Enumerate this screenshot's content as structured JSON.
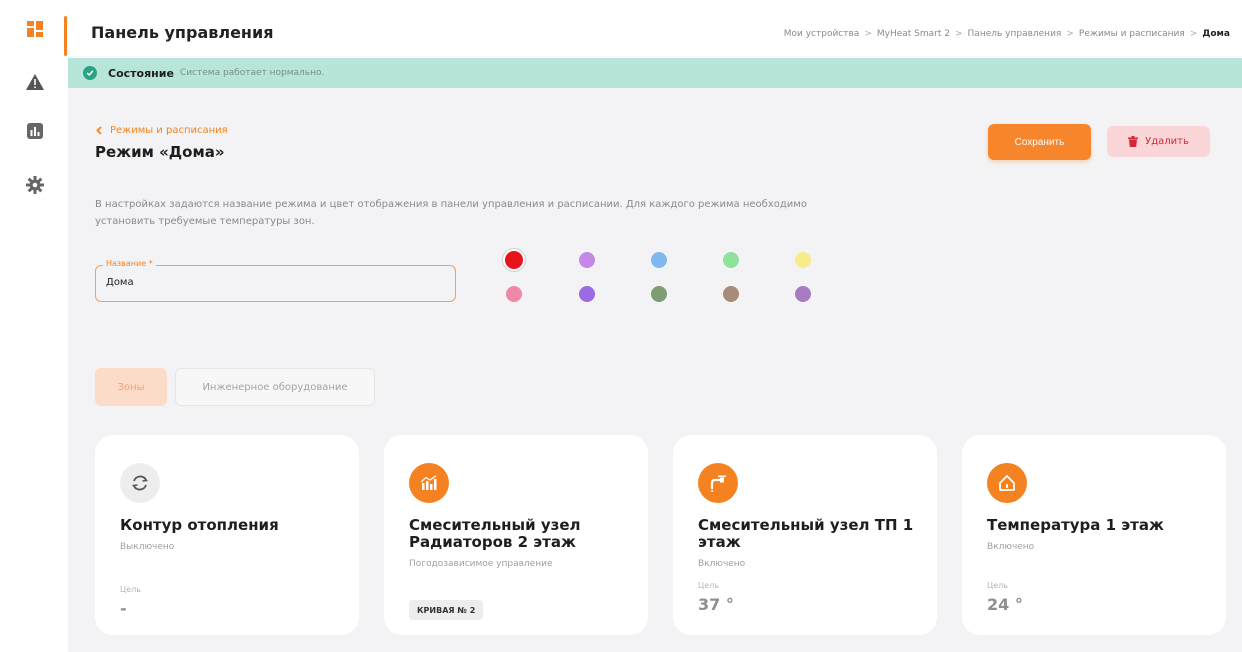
{
  "header": {
    "title": "Панель управления",
    "breadcrumb": [
      "Мои устройства",
      "MyHeat Smart 2",
      "Панель управления",
      "Режимы и расписания"
    ],
    "breadcrumb_current": "Дома",
    "breadcrumb_sep": ">"
  },
  "sidebar": {
    "items": [
      {
        "icon": "dashboard-icon"
      },
      {
        "icon": "warning-icon"
      },
      {
        "icon": "stats-icon"
      },
      {
        "icon": "gear-icon"
      }
    ]
  },
  "status": {
    "label": "Состояние",
    "message": "Система работает нормально."
  },
  "mode": {
    "back_label": "Режимы и расписания",
    "title": "Режим «Дома»",
    "save_label": "Сохранить",
    "delete_label": "Удалить",
    "description": "В настройках задаются название режима и цвет отображения в панели управления и расписании. Для каждого режима необходимо установить требуемые температуры зон.",
    "name_label": "Название *",
    "name_value": "Дома"
  },
  "colors": {
    "accent": "#f58220",
    "palette": [
      "#e8141b",
      "#c688e8",
      "#7fb9ee",
      "#8ee39a",
      "#f6ec8a",
      "#ef87a8",
      "#9c6ae3",
      "#7d9d72",
      "#a88b7a",
      "#a77bc2"
    ],
    "selected_index": 0
  },
  "tabs": [
    {
      "label": "Зоны",
      "active": true
    },
    {
      "label": "Инженерное оборудование",
      "active": false
    }
  ],
  "zones": [
    {
      "title": "Контур отопления",
      "state": "Выключено",
      "goal_label": "Цель",
      "goal_value": "-",
      "icon": "cycle-icon"
    },
    {
      "title": "Смесительный узел Радиаторов 2 этаж",
      "state": "Погодозависимое управление",
      "badge": "КРИВАЯ № 2",
      "icon": "chart-icon"
    },
    {
      "title": "Смесительный узел ТП 1 этаж",
      "state": "Включено",
      "goal_label": "Цель",
      "goal_value": "37 °",
      "icon": "tap-icon"
    },
    {
      "title": "Температура 1 этаж",
      "state": "Включено",
      "goal_label": "Цель",
      "goal_value": "24 °",
      "icon": "house-icon"
    }
  ]
}
